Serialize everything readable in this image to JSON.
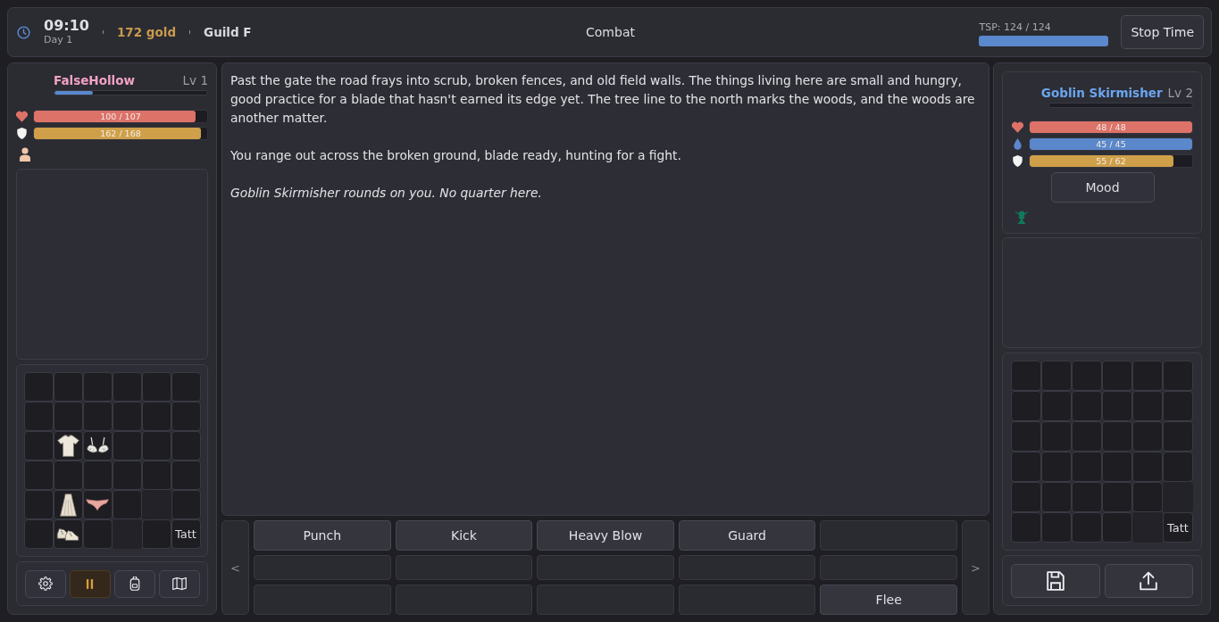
{
  "top_bar": {
    "time": "09:10",
    "day": "Day 1",
    "gold": "172 gold",
    "guild": "Guild F",
    "mode": "Combat",
    "tsp": {
      "label": "TSP: 124 / 124",
      "level": 1
    },
    "stop_button": "Stop Time"
  },
  "player": {
    "name": "FalseHollow",
    "level_label": "Lv 1",
    "xp": {
      "level": 0.25
    },
    "stats": [
      {
        "kind": "health",
        "reading": "100 / 107",
        "level": 0.935
      },
      {
        "kind": "armor",
        "reading": "162 / 168",
        "level": 0.964
      }
    ],
    "equipment": [
      [
        {
          "kind": "empty"
        },
        {
          "kind": "empty"
        },
        {
          "kind": "empty"
        },
        {
          "kind": "empty"
        },
        {
          "kind": "empty"
        },
        {
          "kind": "empty"
        }
      ],
      [
        {
          "kind": "empty"
        },
        {
          "kind": "empty"
        },
        {
          "kind": "empty"
        },
        {
          "kind": "empty"
        },
        {
          "kind": "empty"
        },
        {
          "kind": "empty"
        }
      ],
      [
        {
          "kind": "empty"
        },
        {
          "kind": "shirt"
        },
        {
          "kind": "bra"
        },
        {
          "kind": "empty"
        },
        {
          "kind": "empty"
        },
        {
          "kind": "empty"
        }
      ],
      [
        {
          "kind": "empty"
        },
        {
          "kind": "empty"
        },
        {
          "kind": "empty"
        },
        {
          "kind": "empty"
        },
        {
          "kind": "empty"
        },
        {
          "kind": "empty"
        }
      ],
      [
        {
          "kind": "empty"
        },
        {
          "kind": "dress"
        },
        {
          "kind": "briefs"
        },
        {
          "kind": "empty"
        },
        {
          "kind": "faded"
        },
        {
          "kind": "empty"
        }
      ],
      [
        {
          "kind": "empty"
        },
        {
          "kind": "shoes"
        },
        {
          "kind": "empty"
        },
        {
          "kind": "faded"
        },
        {
          "kind": "empty"
        },
        {
          "kind": "label",
          "label": "Tatt"
        }
      ]
    ],
    "toolbar": [
      {
        "kind": "settings",
        "selected": false
      },
      {
        "kind": "pause",
        "selected": true
      },
      {
        "kind": "backpack",
        "selected": false
      },
      {
        "kind": "map",
        "selected": false
      }
    ]
  },
  "story": [
    {
      "kind": "narration",
      "text": "Past the gate the road frays into scrub, broken fences, and old field walls. The things living here are small and hungry, good practice for a blade that hasn't earned its edge yet. The tree line to the north marks the woods, and the woods are another matter."
    },
    {
      "kind": "narration",
      "text": "You range out across the broken ground, blade ready, hunting for a fight."
    },
    {
      "kind": "encounter",
      "text": "Goblin Skirmisher rounds on you. No quarter here."
    }
  ],
  "actions": {
    "prev": "<",
    "next": ">",
    "rows": [
      [
        {
          "kind": "button",
          "label": "Punch"
        },
        {
          "kind": "button",
          "label": "Kick"
        },
        {
          "kind": "button",
          "label": "Heavy Blow"
        },
        {
          "kind": "button",
          "label": "Guard"
        },
        {
          "kind": "empty"
        }
      ],
      [
        {
          "kind": "empty"
        },
        {
          "kind": "empty"
        },
        {
          "kind": "empty"
        },
        {
          "kind": "empty"
        },
        {
          "kind": "empty"
        }
      ],
      [
        {
          "kind": "empty"
        },
        {
          "kind": "empty"
        },
        {
          "kind": "empty"
        },
        {
          "kind": "empty"
        },
        {
          "kind": "button",
          "label": "Flee"
        }
      ]
    ]
  },
  "enemy": {
    "name": "Goblin Skirmisher",
    "level_label": "Lv 2",
    "xp": {
      "level": 0
    },
    "stats": [
      {
        "kind": "health",
        "reading": "48 / 48",
        "level": 1
      },
      {
        "kind": "mana",
        "reading": "45 / 45",
        "level": 1
      },
      {
        "kind": "armor",
        "reading": "55 / 62",
        "level": 0.887
      }
    ],
    "mood_button": "Mood",
    "equipment": [
      [
        {
          "kind": "empty"
        },
        {
          "kind": "empty"
        },
        {
          "kind": "empty"
        },
        {
          "kind": "empty"
        },
        {
          "kind": "empty"
        },
        {
          "kind": "empty"
        }
      ],
      [
        {
          "kind": "empty"
        },
        {
          "kind": "empty"
        },
        {
          "kind": "empty"
        },
        {
          "kind": "empty"
        },
        {
          "kind": "empty"
        },
        {
          "kind": "empty"
        }
      ],
      [
        {
          "kind": "empty"
        },
        {
          "kind": "empty"
        },
        {
          "kind": "empty"
        },
        {
          "kind": "empty"
        },
        {
          "kind": "empty"
        },
        {
          "kind": "empty"
        }
      ],
      [
        {
          "kind": "empty"
        },
        {
          "kind": "empty"
        },
        {
          "kind": "empty"
        },
        {
          "kind": "empty"
        },
        {
          "kind": "empty"
        },
        {
          "kind": "empty"
        }
      ],
      [
        {
          "kind": "empty"
        },
        {
          "kind": "empty"
        },
        {
          "kind": "empty"
        },
        {
          "kind": "empty"
        },
        {
          "kind": "empty"
        },
        {
          "kind": "faded"
        }
      ],
      [
        {
          "kind": "empty"
        },
        {
          "kind": "empty"
        },
        {
          "kind": "empty"
        },
        {
          "kind": "empty"
        },
        {
          "kind": "faded"
        },
        {
          "kind": "label",
          "label": "Tatt"
        }
      ]
    ],
    "buttons": [
      {
        "kind": "save"
      },
      {
        "kind": "export"
      }
    ]
  }
}
